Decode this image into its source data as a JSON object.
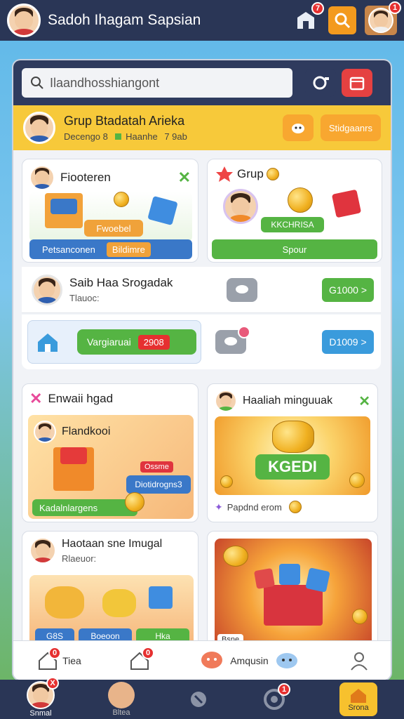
{
  "app": {
    "title": "Sadoh Ihagam Sapsian"
  },
  "header": {
    "notif_badge": "7",
    "profile_badge": "1"
  },
  "search": {
    "placeholder": "Ilaandhosshiangont"
  },
  "group_strip": {
    "title": "Grup Btadatah Arieka",
    "sub_left": "Decengo 8",
    "sub_mid": "Haanhe",
    "sub_right": "7 9ab",
    "button_label": "Stidgaanrs"
  },
  "cards": {
    "friends": {
      "title": "Fiooteren",
      "label_small": "Fwoebel",
      "button_label": "Petsanconen",
      "button_tag": "Bildimre"
    },
    "group": {
      "title": "Grup",
      "label": "KKCHRISA",
      "button_label": "Spour"
    },
    "row1": {
      "title": "Saib Haa Srogadak",
      "sub": "Tlauoc:",
      "button_label": "G1000 >"
    },
    "row2": {
      "button_label": "Vargiaruai",
      "tag": "2908",
      "chat_badge": "",
      "right_button": "D1009 >"
    },
    "events": {
      "title": "Enwaii hgad",
      "inner_title": "Flandkooi",
      "tag": "Ossme",
      "button_label": "Diotidrogns3",
      "green_label": "Kadalnlargens"
    },
    "reward": {
      "title": "Haaliah minguuak",
      "banner_label": "KGEDI",
      "footer": "Papdnd erom"
    },
    "hatian": {
      "title": "Haotaan sne Imugal",
      "sub": "Rlaeuor:",
      "pill1": "G8S",
      "pill2": "Boeoon",
      "pill3": "Hka"
    },
    "giftbox": {
      "footer": "Bsne"
    }
  },
  "inner_nav": {
    "items": [
      {
        "label": "Tiea",
        "icon": "home-icon",
        "badge": "0"
      },
      {
        "label": "",
        "icon": "home-outline-icon",
        "badge": "0"
      },
      {
        "label": "Amqusin",
        "icon": "chat-bubble-icon",
        "badge": ""
      },
      {
        "label": "",
        "icon": "person-icon",
        "badge": ""
      }
    ]
  },
  "bottom_nav": {
    "items": [
      {
        "label": "Snmal",
        "icon": "avatar-icon",
        "badge": "X"
      },
      {
        "label": "Bltea",
        "icon": "baby-avatar-icon",
        "badge": ""
      },
      {
        "label": "",
        "icon": "bell-icon",
        "badge": ""
      },
      {
        "label": "",
        "icon": "gear-icon",
        "badge": "1"
      },
      {
        "label": "Srona",
        "icon": "home-icon",
        "badge": ""
      }
    ]
  },
  "colors": {
    "navy": "#2a3656",
    "yellow": "#f7c93a",
    "green": "#55b443",
    "blue": "#3a78c8",
    "orange": "#f0a23a",
    "red": "#e63030"
  }
}
